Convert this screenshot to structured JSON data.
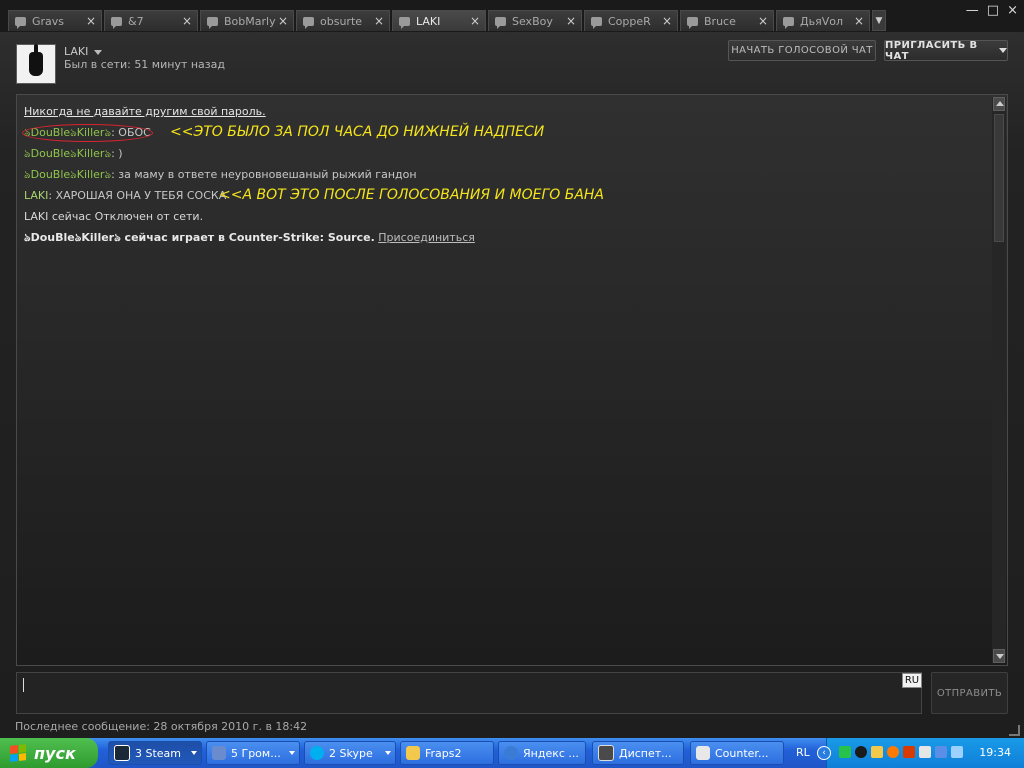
{
  "tabs": [
    {
      "label": "Gravs",
      "active": false
    },
    {
      "label": "&7",
      "active": false
    },
    {
      "label": "BobMarly",
      "active": false
    },
    {
      "label": "obsurte",
      "active": false
    },
    {
      "label": "LAKI",
      "active": true
    },
    {
      "label": "SexBoy",
      "active": false
    },
    {
      "label": "CoppeR",
      "active": false
    },
    {
      "label": "Bruce",
      "active": false
    },
    {
      "label": "ДьяVол",
      "active": false
    }
  ],
  "tab_close_glyph": "×",
  "window": {
    "min": "—",
    "max": "□",
    "close": "×"
  },
  "header": {
    "name": "LAKI",
    "status": "Был в сети: 51 минут назад",
    "voice_button": "НАЧАТЬ ГОЛОСОВОЙ ЧАТ",
    "invite_button": "ПРИГЛАСИТЬ В ЧАТ"
  },
  "chat": {
    "warning": "Никогда не давайте другим свой пароль.",
    "messages": [
      {
        "nick": "ঌDouBleঌKillerঌ",
        "text": ": ОБОС"
      },
      {
        "nick": "ঌDouBleঌKillerঌ",
        "text": ": )"
      },
      {
        "nick": "ঌDouBleঌKillerঌ",
        "text": ": за маму в ответе неуровновешаный рыжий гандон"
      },
      {
        "nick": "LAKI",
        "text": ": ХАРОШАЯ ОНА У ТЕБЯ СОСКА"
      }
    ],
    "status_offline": "LAKI сейчас Отключен от сети.",
    "status_game": "ঌDouBleঌKillerঌ сейчас играет в Counter-Strike: Source.",
    "join_link": "Присоединиться",
    "annotation_1": "<<ЭТО БЫЛО ЗА ПОЛ ЧАСА ДО НИЖНЕЙ НАДПЕСИ",
    "annotation_2": "<<А ВОТ  ЭТО ПОСЛЕ ГОЛОСОВАНИЯ И МОЕГО БАНА"
  },
  "input": {
    "lang": "RU",
    "send_button": "ОТПРАВИТЬ"
  },
  "last_message": "Последнее сообщение: 28 октября 2010 г. в 18:42",
  "taskbar": {
    "start": "пуск",
    "buttons": [
      {
        "label": "3 Steam",
        "icon_color": "#1b2838",
        "dropdown": true
      },
      {
        "label": "5 Гром...",
        "icon_color": "#6a8ccf",
        "dropdown": true
      },
      {
        "label": "2 Skype",
        "icon_color": "#00aff0",
        "dropdown": true
      },
      {
        "label": "Fraps2",
        "icon_color": "#f2c94c",
        "dropdown": false
      },
      {
        "label": "Яндекс ...",
        "icon_color": "#3a7bd5",
        "dropdown": false
      },
      {
        "label": "Диспет...",
        "icon_color": "#4a4a4a",
        "dropdown": false
      },
      {
        "label": "Counter...",
        "icon_color": "#e8e8e8",
        "dropdown": false
      }
    ],
    "lang": "RL",
    "clock": "19:34"
  }
}
